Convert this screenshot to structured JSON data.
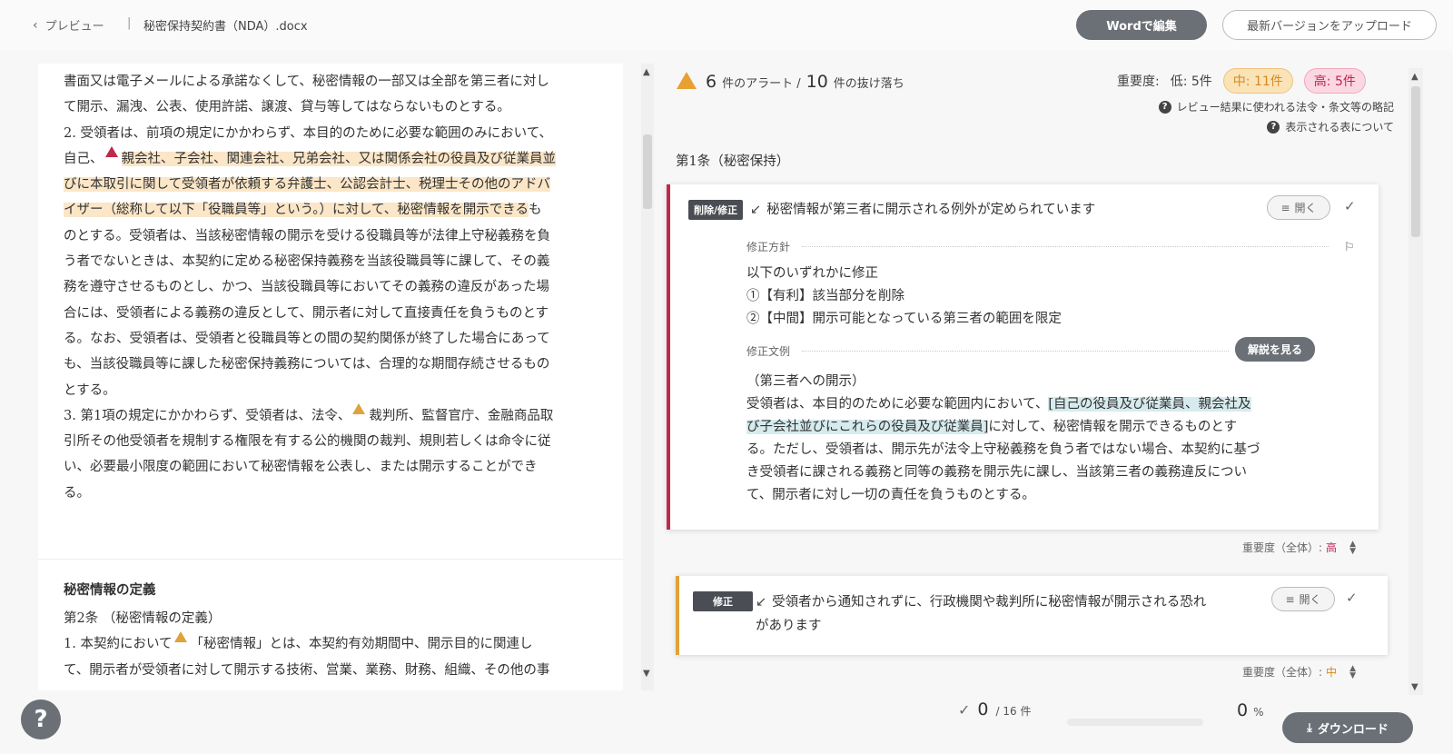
{
  "topbar": {
    "back_label": "プレビュー",
    "separator": "|",
    "doc_title": "秘密保持契約書（NDA）.docx",
    "word_edit_label": "Wordで編集",
    "upload_label": "最新バージョンをアップロード"
  },
  "document": {
    "lines_1": [
      "書面又は電子メールによる承諾なくして、秘密情報の一部又は全部を第三者に対し",
      "て開示、漏洩、公表、使用許諾、譲渡、貸与等してはならないものとする。",
      "2. 受領者は、前項の規定にかかわらず、本目的のために必要な範囲のみにおいて、"
    ],
    "line_4_pre": "自己、",
    "line_4_hl": "親会社、子会社、関連会社、兄弟会社、又は関係会社の役員及び従業員並",
    "line_5_hl": "びに本取引に関して受領者が依頼する弁護士、公認会計士、税理士その他のアドバ",
    "line_6_hl": "イザー（総称して以下「役職員等」という。）に対して、秘密情報を開示できる",
    "line_6_post": "も",
    "lines_2": [
      "のとする。受領者は、当該秘密情報の開示を受ける役職員等が法律上守秘義務を負",
      "う者でないときは、本契約に定める秘密保持義務を当該役職員等に課して、その義",
      "務を遵守させるものとし、かつ、当該役職員等においてその義務の違反があった場",
      "合には、受領者による義務の違反として、開示者に対して直接責任を負うものとす",
      "る。なお、受領者は、受領者と役職員等との間の契約関係が終了した場合にあって",
      "も、当該役職員等に課した秘密保持義務については、合理的な期間存続させるもの",
      "とする。"
    ],
    "line_14_pre": "3. 第1項の規定にかかわらず、受領者は、法令、",
    "line_14_post": "裁判所、監督官庁、金融商品取",
    "lines_3": [
      "引所その他受領者を規制する権限を有する公的機関の裁判、規則若しくは命令に従",
      "い、必要最小限度の範囲において秘密情報を公表し、または開示することができ",
      "る。"
    ],
    "section_heading": "秘密情報の定義",
    "article_2_title": "第2条 （秘密情報の定義）",
    "art2_line1_pre": "1. 本契約において",
    "art2_line1_post": "「秘密情報」とは、本契約有効期間中、開示目的に関連し",
    "art2_line2": "て、開示者が受領者に対して開示する技術、営業、業務、財務、組織、その他の事"
  },
  "review": {
    "alert_count": "6",
    "alert_label": "件のアラート /",
    "missing_count": "10",
    "missing_label": "件の抜け落ち",
    "severity_label": "重要度:",
    "severity_low": "低: 5件",
    "severity_mid": "中: 11件",
    "severity_high": "高: 5件",
    "help_abbrev": "レビュー結果に使われる法令・条文等の略記",
    "help_table": "表示される表について",
    "article_title": "第1条（秘密保持）",
    "card1": {
      "tag": "削除/修正",
      "title": "秘密情報が第三者に開示される例外が定められています",
      "open_label": "開く",
      "policy_label": "修正方針",
      "policy_lines": [
        "以下のいずれかに修正",
        "①【有利】該当部分を削除",
        "②【中間】開示可能となっている第三者の範囲を限定"
      ],
      "sample_label": "修正文例",
      "explain_label": "解説を見る",
      "sample_heading": "（第三者への開示）",
      "sample_l1_pre": "受領者は、本目的のために必要な範囲内において、",
      "sample_l1_hl": "[自己の役員及び従業員、親会社及",
      "sample_l2_hl": "び子会社並びにこれらの役員及び従業員]",
      "sample_l2_post": "に対して、秘密情報を開示できるものとす",
      "sample_rest": [
        "る。ただし、受領者は、開示先が法令上守秘義務を負う者ではない場合、本契約に基づ",
        "き受領者に課される義務と同等の義務を開示先に課し、当該第三者の義務違反につい",
        "て、開示者に対し一切の責任を負うものとする。"
      ],
      "overall_label": "重要度（全体）:",
      "overall_value": "高"
    },
    "card2": {
      "tag": "修正",
      "title_l1": "受領者から通知されずに、行政機関や裁判所に秘密情報が開示される恐れ",
      "title_l2": "があります",
      "open_label": "開く",
      "overall_label": "重要度（全体）:",
      "overall_value": "中"
    }
  },
  "footer": {
    "help_glyph": "?",
    "progress_count": "0",
    "progress_total": "/ 16 件",
    "percent_value": "0",
    "percent_sign": "%",
    "progress_fraction": 0,
    "download_label": "ダウンロード"
  }
}
